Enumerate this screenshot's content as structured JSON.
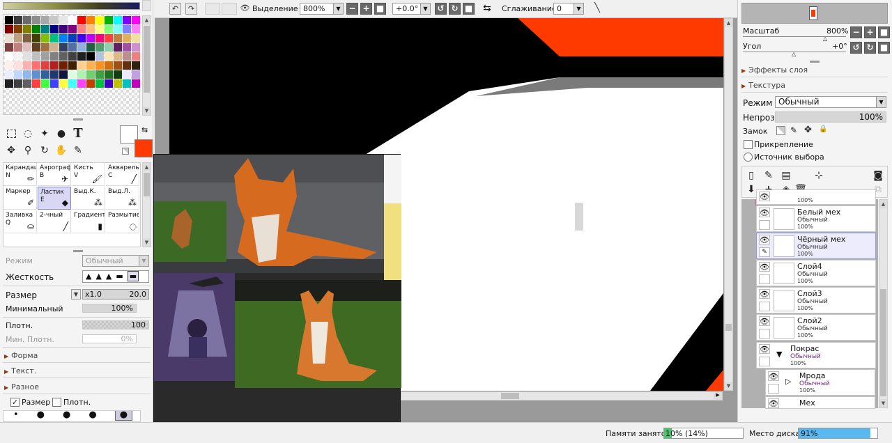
{
  "toolbar": {
    "selection_label": "Выделение",
    "zoom_value": "800%",
    "angle_value": "+0.0°",
    "smoothing_label": "Сглаживание",
    "smoothing_value": "0"
  },
  "left_panel": {
    "mode_label": "Режим",
    "mode_value": "Обычный",
    "hardness_label": "Жесткость",
    "size_label": "Размер",
    "size_mult": "x1.0",
    "size_value": "20.0",
    "min_label": "Минимальный",
    "min_value": "100%",
    "density_label": "Плотн.",
    "density_value": "100",
    "min_density_label": "Мин. Плотн.",
    "min_density_value": "0%",
    "sections": [
      "Форма",
      "Текст.",
      "Разное"
    ],
    "size_checkbox": "Размер",
    "density_checkbox": "Плотн."
  },
  "brushes": [
    {
      "name": "Карандаш",
      "key": "N",
      "icon": "pencil-icon"
    },
    {
      "name": "Аэрограф",
      "key": "B",
      "icon": "airbrush-icon"
    },
    {
      "name": "Кисть",
      "key": "V",
      "icon": "brush-icon"
    },
    {
      "name": "Акварель",
      "key": "C",
      "icon": "watercolor-icon"
    },
    {
      "name": "Маркер",
      "key": "",
      "icon": "marker-icon"
    },
    {
      "name": "Ластик",
      "key": "E",
      "icon": "eraser-icon"
    },
    {
      "name": "Выд.К.",
      "key": "",
      "icon": "select-pen-icon"
    },
    {
      "name": "Выд.Л.",
      "key": "",
      "icon": "select-eraser-icon"
    },
    {
      "name": "Заливка",
      "key": "Q",
      "icon": "bucket-icon"
    },
    {
      "name": "2-чный",
      "key": "",
      "icon": "binary-pen-icon"
    },
    {
      "name": "Градиент",
      "key": "",
      "icon": "gradient-icon"
    },
    {
      "name": "Размытие",
      "key": "",
      "icon": "blur-icon"
    }
  ],
  "palette": [
    "#000000",
    "#3a3a3a",
    "#6b6b6b",
    "#8e8e8e",
    "#a8a8a8",
    "#c8c8c8",
    "#e6e6e6",
    "#ffffff",
    "#ff0000",
    "#ff8000",
    "#ffff00",
    "#00b000",
    "#00ffff",
    "#8000ff",
    "#ff00ff",
    "#800000",
    "#804000",
    "#808000",
    "#008000",
    "#008080",
    "#000080",
    "#400080",
    "#800080",
    "#ff8080",
    "#ffc080",
    "#ffff80",
    "#80ff80",
    "#80ffff",
    "#8080ff",
    "#ff80ff",
    "#e8e0d0",
    "#c0a080",
    "#806040",
    "#404000",
    "#80c000",
    "#00c080",
    "#0080ff",
    "#0040c0",
    "#4000ff",
    "#c000ff",
    "#ff0080",
    "#ff4040",
    "#c08040",
    "#e0b060",
    "#f0e0a0",
    "#804040",
    "#c08080",
    "#e0c0c0",
    "#604020",
    "#a07040",
    "#d0b090",
    "#304060",
    "#5070a0",
    "#90b0e0",
    "#206040",
    "#50a070",
    "#90d0b0",
    "#602060",
    "#a050a0",
    "#d090d0",
    "#ffffff",
    "#f4f4f4",
    "#e0e0e0",
    "#c0c0c0",
    "#a0a0a0",
    "#808080",
    "#606060",
    "#404040",
    "#202020",
    "#000000",
    "#b0c4de",
    "#ffe4b5",
    "#deb887",
    "#bc8f8f",
    "#f08080",
    "#fff0f0",
    "#ffe0e0",
    "#ffb0b0",
    "#ff7070",
    "#e04040",
    "#b02020",
    "#702000",
    "#402000",
    "#ffd090",
    "#ffb050",
    "#ff9020",
    "#d07010",
    "#a05010",
    "#603010",
    "#302010",
    "#e8f0ff",
    "#c0d8ff",
    "#90b8f0",
    "#6090d0",
    "#3060a0",
    "#203870",
    "#101840",
    "#e0ffe0",
    "#b0f0b0",
    "#70d070",
    "#40a040",
    "#207020",
    "#104010",
    "#f0e8ff",
    "#c0a0e0",
    "#202020",
    "#404040",
    "#606060",
    "#ff4040",
    "#40ff40",
    "#4040ff",
    "#ffff40",
    "#40ffff",
    "#ff40ff",
    "#c04000",
    "#00c040",
    "#4000c0",
    "#c0c000",
    "#00c0c0",
    "#c000c0"
  ],
  "colors": {
    "primary": "#ffffff",
    "secondary": "#ff3a00",
    "accent": "#ff3a00"
  },
  "right_panel": {
    "scale_label": "Масштаб",
    "scale_value": "800%",
    "angle_label": "Угол",
    "angle_value": "+0°",
    "effects_label": "Эффекты слоя",
    "texture_label": "Текстура",
    "mode_label": "Режим",
    "mode_value": "Обычный",
    "opacity_label": "Непроз.",
    "opacity_value": "100%",
    "lock_label": "Замок",
    "clip_label": "Прикрепление",
    "source_label": "Источник выбора"
  },
  "layers": [
    {
      "name": "",
      "mode": "",
      "opacity": "100%"
    },
    {
      "name": "Белый мех",
      "mode": "Обычный",
      "opacity": "100%"
    },
    {
      "name": "Чёрный мех",
      "mode": "Обычный",
      "opacity": "100%"
    },
    {
      "name": "Слой4",
      "mode": "Обычный",
      "opacity": "100%"
    },
    {
      "name": "Слой3",
      "mode": "Обычный",
      "opacity": "100%"
    },
    {
      "name": "Слой2",
      "mode": "Обычный",
      "opacity": "100%"
    },
    {
      "name": "Покрас",
      "mode": "Обычный",
      "opacity": "100%"
    },
    {
      "name": "Мрода",
      "mode": "Обычный",
      "opacity": "100%"
    },
    {
      "name": "Мех",
      "mode": "",
      "opacity": ""
    }
  ],
  "status": {
    "memory_label": "Памяти занято",
    "memory_value": "10% (14%)",
    "memory_fill": 0.1,
    "disk_label": "Место диска",
    "disk_value": "91%",
    "disk_fill": 0.91
  }
}
